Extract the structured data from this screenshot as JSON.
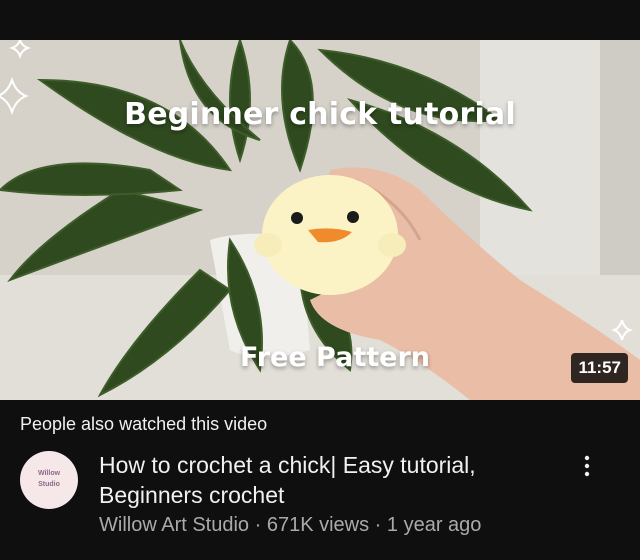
{
  "thumbnail": {
    "overlay_title": "Beginner chick tutorial",
    "overlay_subtitle": "Free Pattern",
    "duration": "11:57"
  },
  "section": {
    "label": "People also watched this video"
  },
  "video": {
    "title": "How to crochet a chick| Easy tutorial, Beginners crochet",
    "channel": "Willow Art Studio",
    "views": "671K views",
    "age": "1 year ago",
    "meta_separator": " · ",
    "avatar_text_line1": "Willow",
    "avatar_text_line2": "Studio"
  },
  "icons": {
    "more": "vertical-ellipsis-icon",
    "sparkle": "sparkle-icon"
  }
}
